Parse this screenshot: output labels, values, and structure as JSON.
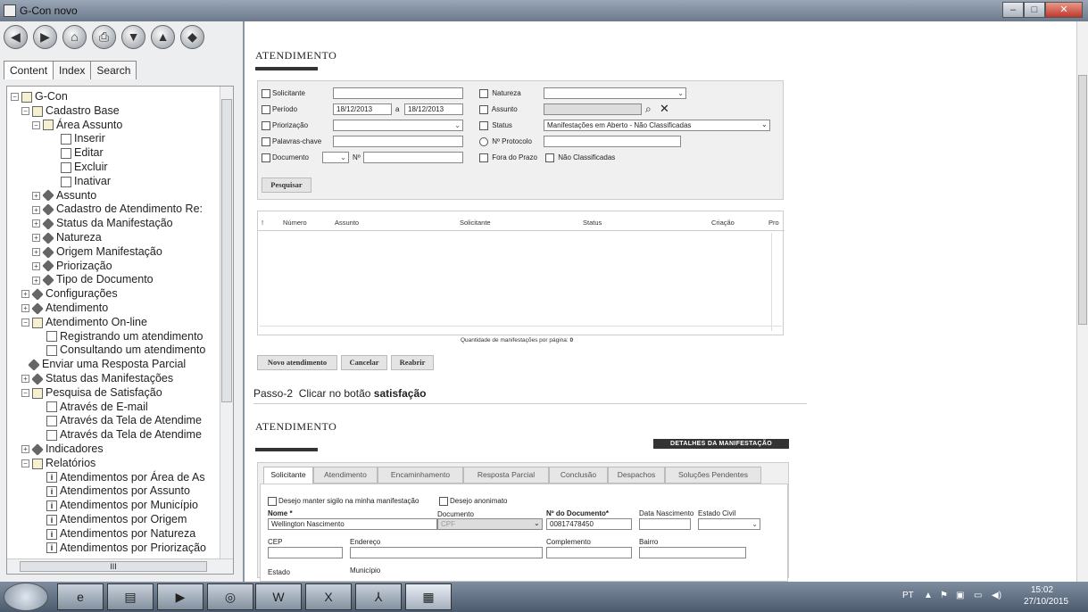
{
  "window": {
    "title": "G-Con novo"
  },
  "help": {
    "toolbar": [
      "back-icon",
      "forward-icon",
      "home-icon",
      "print-icon",
      "down-icon",
      "up-icon",
      "options-icon"
    ],
    "tabs": [
      "Content",
      "Index",
      "Search"
    ],
    "tree": [
      {
        "label": "G-Con",
        "exp": "⊟",
        "icon": "book"
      },
      {
        "label": "Cadastro Base",
        "exp": "⊟",
        "icon": "book"
      },
      {
        "label": "Área Assunto",
        "exp": "⊟",
        "icon": "book"
      },
      {
        "label": "Inserir",
        "exp": "",
        "icon": "page"
      },
      {
        "label": "Editar",
        "exp": "",
        "icon": "page"
      },
      {
        "label": "Excluir",
        "exp": "",
        "icon": "page"
      },
      {
        "label": "Inativar",
        "exp": "",
        "icon": "page"
      },
      {
        "label": "Assunto",
        "exp": "⊞",
        "icon": "gem"
      },
      {
        "label": "Cadastro de Atendimento Re:",
        "exp": "⊞",
        "icon": "gem"
      },
      {
        "label": "Status da Manifestação",
        "exp": "⊞",
        "icon": "gem"
      },
      {
        "label": "Natureza",
        "exp": "⊞",
        "icon": "gem"
      },
      {
        "label": "Origem Manifestação",
        "exp": "⊞",
        "icon": "gem"
      },
      {
        "label": "Priorização",
        "exp": "⊞",
        "icon": "gem"
      },
      {
        "label": "Tipo de Documento",
        "exp": "⊞",
        "icon": "gem"
      },
      {
        "label": "Configurações",
        "exp": "⊞",
        "icon": "gem"
      },
      {
        "label": "Atendimento",
        "exp": "⊞",
        "icon": "gem"
      },
      {
        "label": "Atendimento On-line",
        "exp": "⊟",
        "icon": "book"
      },
      {
        "label": "Registrando um atendimento",
        "exp": "",
        "icon": "page"
      },
      {
        "label": "Consultando um atendimento",
        "exp": "",
        "icon": "page"
      },
      {
        "label": "Enviar uma Resposta Parcial",
        "exp": "",
        "icon": "gem"
      },
      {
        "label": "Status das Manifestações",
        "exp": "⊞",
        "icon": "gem"
      },
      {
        "label": "Pesquisa de Satisfação",
        "exp": "⊟",
        "icon": "book"
      },
      {
        "label": "Através de E-mail",
        "exp": "",
        "icon": "page"
      },
      {
        "label": "Através da Tela de Atendime",
        "exp": "",
        "icon": "page"
      },
      {
        "label": "Através da Tela de Atendime",
        "exp": "",
        "icon": "page"
      },
      {
        "label": "Indicadores",
        "exp": "⊞",
        "icon": "gem"
      },
      {
        "label": "Relatórios",
        "exp": "⊟",
        "icon": "book"
      },
      {
        "label": "Atendimentos por Área de As",
        "exp": "",
        "icon": "info"
      },
      {
        "label": "Atendimentos por Assunto",
        "exp": "",
        "icon": "info"
      },
      {
        "label": "Atendimentos por Município",
        "exp": "",
        "icon": "info"
      },
      {
        "label": "Atendimentos por Origem",
        "exp": "",
        "icon": "info"
      },
      {
        "label": "Atendimentos por Natureza",
        "exp": "",
        "icon": "info"
      },
      {
        "label": "Atendimentos por Priorização",
        "exp": "",
        "icon": "info"
      }
    ],
    "hscroll_label": "III"
  },
  "page": {
    "section1_title": "ATENDIMENTO",
    "filters": {
      "solicitante": "Solicitante",
      "periodo": "Período",
      "periodo_from": "18/12/2013",
      "periodo_sep": "a",
      "periodo_to": "18/12/2013",
      "priorizacao": "Priorização",
      "palavras": "Palavras-chave",
      "documento": "Documento",
      "nro": "Nº",
      "natureza": "Natureza",
      "assunto": "Assunto",
      "status": "Status",
      "status_value": "Manifestações em Aberto - Não Classificadas",
      "protocolo": "Nº Protocolo",
      "fora_prazo": "Fora do Prazo",
      "nao_class": "Não Classificadas"
    },
    "pesquisar": "Pesquisar",
    "grid_headers": [
      "!",
      "Número",
      "Assunto",
      "Solicitante",
      "Status",
      "Criação",
      "Pro"
    ],
    "qtd_label": "Quantidade de manifestações por página:",
    "qtd_value": "0",
    "buttons": [
      "Novo atendimento",
      "Cancelar",
      "Reabrir"
    ],
    "passo_prefix": "Passo-2",
    "passo_text": "Clicar no botão",
    "passo_bold": "satisfação",
    "section2_title": "ATENDIMENTO",
    "detalhes": "DETALHES DA MANIFESTAÇÃO",
    "detail_tabs": [
      "Solicitante",
      "Atendimento",
      "Encaminhamento",
      "Resposta Parcial",
      "Conclusão",
      "Despachos",
      "Soluções Pendentes"
    ],
    "sigilo": "Desejo manter sigilo na minha manifestação",
    "anonimo": "Desejo anonimato",
    "nome_label": "Nome *",
    "nome_value": "Wellington Nascimento",
    "documento_label": "Documento",
    "documento_value": "CPF",
    "nrodoc_label": "Nº do Documento*",
    "nrodoc_value": "00817478450",
    "nasc_label": "Data Nascimento",
    "civil_label": "Estado Civil",
    "cep_label": "CEP",
    "endereco_label": "Endereço",
    "complemento_label": "Complemento",
    "bairro_label": "Bairro",
    "estado_label": "Estado",
    "municipio_label": "Município"
  },
  "taskbar": {
    "lang": "PT",
    "time": "15:02",
    "date": "27/10/2015"
  }
}
